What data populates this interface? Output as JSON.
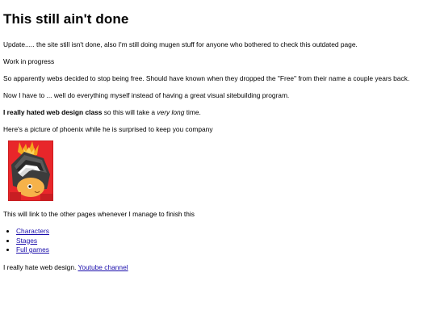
{
  "page": {
    "title": "This still ain't done",
    "paragraphs": {
      "update": "Update..... the site still isn't done, also I'm still doing mugen stuff for anyone who bothered to check this outdated page.",
      "wip": "Work in progress",
      "webs": "So apparently webs decided to stop being free. Should have known when they dropped the \"Free\" from their name a couple years back.",
      "now": "Now I have to ... well do everything myself instead of having a great visual sitebuilding program.",
      "hated_bold": "I really hated web design class",
      "hated_rest_a": " so this will take a ",
      "hated_italic": "very long",
      "hated_rest_b": " time.",
      "picture": "Here's a picture of phoenix while he is surprised to keep you company",
      "links_intro": "This will link to the other pages whenever I manage to finish this"
    },
    "links": [
      {
        "label": "Characters"
      },
      {
        "label": "Stages"
      },
      {
        "label": "Full games"
      }
    ],
    "footer": {
      "text": "I really hate web design. ",
      "youtube_label": "Youtube channel"
    },
    "colors": {
      "link": "#1a0dab",
      "image_bg": "#e8262a",
      "helmet": "#4a4a4a",
      "face": "#f6b24a"
    },
    "image": {
      "description_icon": "phoenix-image"
    }
  }
}
